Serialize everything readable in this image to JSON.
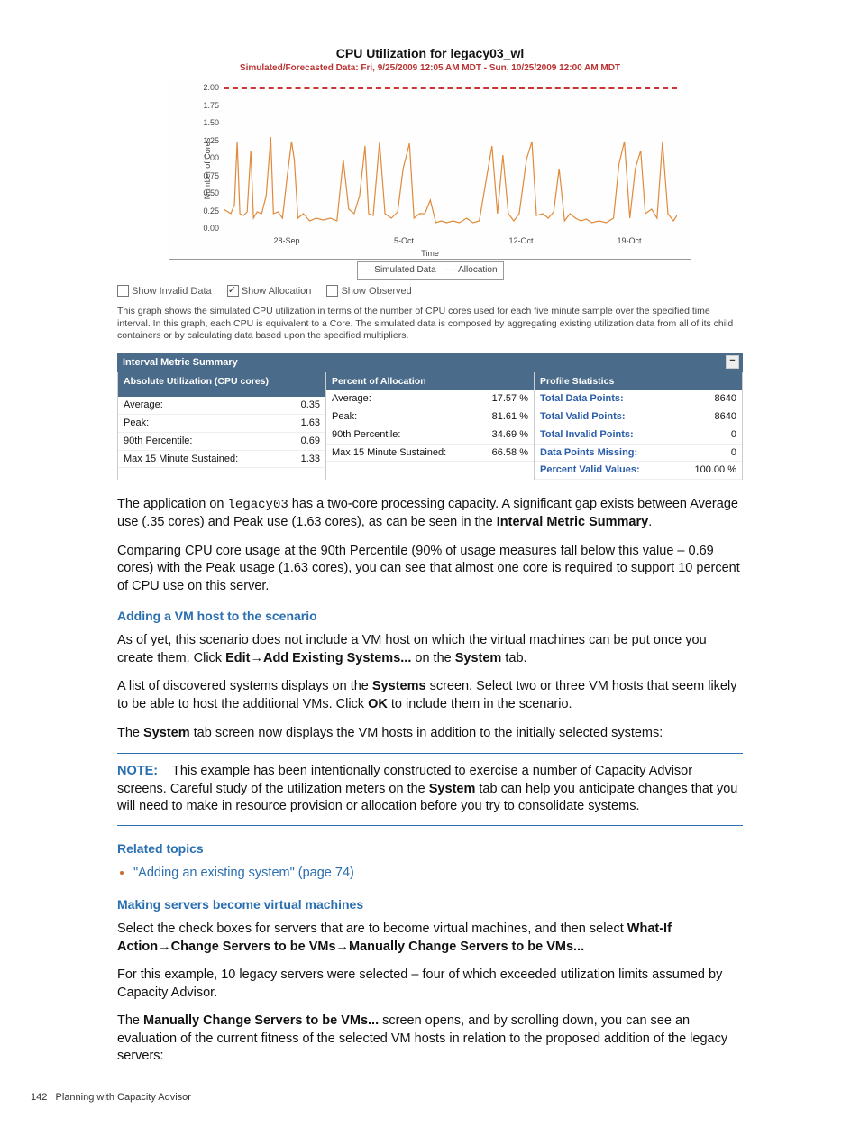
{
  "chart_data": {
    "type": "line",
    "title": "CPU Utilization for legacy03_wl",
    "subtitle": "Simulated/Forecasted Data: Fri, 9/25/2009 12:05 AM MDT - Sun, 10/25/2009 12:00 AM MDT",
    "ylabel": "Number of Cores",
    "xlabel": "Time",
    "ylim": [
      0,
      2.0
    ],
    "yticks": [
      0.0,
      0.25,
      0.5,
      0.75,
      1.0,
      1.25,
      1.5,
      1.75,
      2.0
    ],
    "xticks": [
      "28-Sep",
      "5-Oct",
      "12-Oct",
      "19-Oct"
    ],
    "series": [
      {
        "name": "Simulated Data",
        "color": "#e08a3a",
        "style": "solid"
      },
      {
        "name": "Allocation",
        "color": "#c33",
        "style": "dashed",
        "value": 2.0
      }
    ],
    "summary_stats": {
      "avg": 0.35,
      "peak": 1.63,
      "p90": 0.69
    }
  },
  "legend": {
    "sim": "Simulated Data",
    "alloc": "Allocation"
  },
  "checks": {
    "invalid": "Show Invalid Data",
    "allocation": "Show Allocation",
    "observed": "Show Observed"
  },
  "caption": "This graph shows the simulated CPU utilization in terms of the number of CPU cores used for each five minute sample over the specified time interval. In this graph, each CPU is equivalent to a Core. The simulated data is composed by aggregating existing utilization data from all of its child containers or by calculating data based upon the specified multipliers.",
  "ims": {
    "title": "Interval Metric Summary",
    "col1_header": "Absolute Utilization (CPU cores)",
    "col1": [
      {
        "k": "Average:",
        "v": "0.35"
      },
      {
        "k": "Peak:",
        "v": "1.63"
      },
      {
        "k": "90th Percentile:",
        "v": "0.69"
      },
      {
        "k": "Max 15 Minute Sustained:",
        "v": "1.33"
      }
    ],
    "col2_header": "Percent of Allocation",
    "col2": [
      {
        "k": "Average:",
        "v": "17.57 %"
      },
      {
        "k": "Peak:",
        "v": "81.61 %"
      },
      {
        "k": "90th Percentile:",
        "v": "34.69 %"
      },
      {
        "k": "Max 15 Minute Sustained:",
        "v": "66.58 %"
      }
    ],
    "col3_header": "Profile Statistics",
    "col3": [
      {
        "k": "Total Data Points:",
        "v": "8640"
      },
      {
        "k": "Total Valid Points:",
        "v": "8640"
      },
      {
        "k": "Total Invalid Points:",
        "v": "0"
      },
      {
        "k": "Data Points Missing:",
        "v": "0"
      },
      {
        "k": "Percent Valid Values:",
        "v": "100.00 %"
      }
    ]
  },
  "body": {
    "p1a": "The application on ",
    "p1_mono": "legacy03",
    "p1b": " has a two-core processing capacity. A significant gap exists between Average use (.35 cores) and Peak use (1.63 cores), as can be seen in the ",
    "p1_bold": "Interval Metric Summary",
    "p1c": ".",
    "p2": "Comparing CPU core usage at the 90th Percentile (90% of usage measures fall below this value – 0.69 cores) with the Peak usage (1.63 cores), you can see that almost one core is required to support 10 percent of CPU use on this server.",
    "h_addvm": "Adding a VM host to the scenario",
    "p3a": "As of yet, this scenario does not include a VM host on which the virtual machines can be put once you create them. Click ",
    "p3_b1": "Edit",
    "p3_arrow": "→",
    "p3_b2": "Add Existing Systems...",
    "p3_mid": " on the ",
    "p3_b3": "System",
    "p3_end": " tab.",
    "p4a": "A list of discovered systems displays on the  ",
    "p4_b1": "Systems",
    "p4b": " screen. Select two or three VM hosts that seem likely to be able to host the additional VMs. Click ",
    "p4_b2": "OK",
    "p4c": " to include them in the scenario.",
    "p5a": "The ",
    "p5_b1": "System",
    "p5b": " tab screen now displays the VM hosts in addition to the initially selected systems:",
    "note_label": "NOTE:",
    "note_a": "This example has been intentionally constructed to exercise a number of Capacity Advisor screens. Careful study of the utilization meters on the ",
    "note_b": "System",
    "note_c": " tab can help you anticipate changes that you will need to make in resource provision or allocation before you try to consolidate systems.",
    "h_related": "Related topics",
    "related_link": "\"Adding an existing system\" (page 74)",
    "h_making": "Making servers become virtual machines",
    "p6a": "Select the check boxes for servers that are to become virtual machines, and then select ",
    "p6_b1": "What-If Action",
    "p6_b2": "Change Servers to be VMs",
    "p6_b3": "Manually Change Servers to be VMs...",
    "p7": "For this example, 10 legacy servers were selected – four of which exceeded utilization limits assumed by Capacity Advisor.",
    "p8a": "The ",
    "p8_b1": "Manually Change Servers to be VMs...",
    "p8b": " screen opens, and by scrolling down, you can see an evaluation of the current fitness of the selected VM hosts in relation to the proposed addition of the legacy servers:"
  },
  "footer": {
    "page": "142",
    "section": "Planning with Capacity Advisor"
  }
}
